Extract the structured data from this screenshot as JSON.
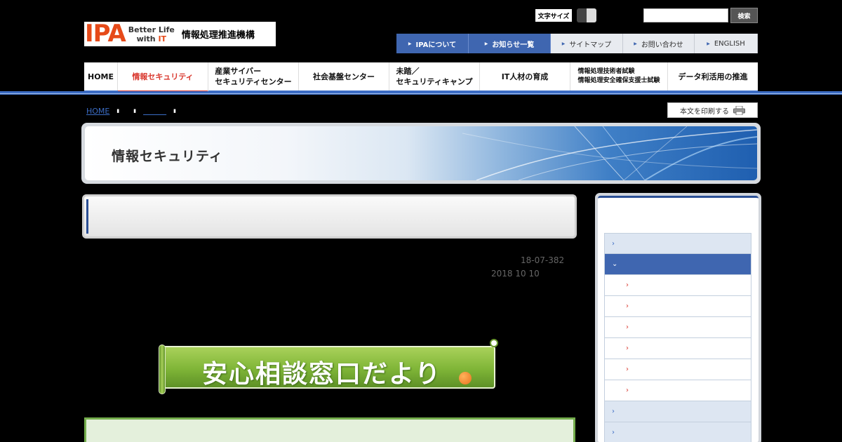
{
  "header": {
    "logo_mark": "IPA",
    "logo_tagline_1": "Better Life",
    "logo_tagline_2a": "with ",
    "logo_tagline_2b": "IT",
    "logo_org": "情報処理推進機構",
    "fontsize_label": "文字サイズ",
    "search_placeholder": "",
    "search_button": "検索"
  },
  "utility_nav": [
    {
      "label": "IPAについて",
      "style": "primary"
    },
    {
      "label": "お知らせ一覧",
      "style": "primary"
    },
    {
      "label": "サイトマップ",
      "style": "secondary"
    },
    {
      "label": "お問い合わせ",
      "style": "secondary"
    },
    {
      "label": "ENGLISH",
      "style": "secondary"
    }
  ],
  "main_nav": [
    {
      "line1": "HOME",
      "line2": ""
    },
    {
      "line1": "情報セキュリティ",
      "line2": "",
      "active": true
    },
    {
      "line1": "産業サイバー",
      "line2": "セキュリティセンター"
    },
    {
      "line1": "社会基盤センター",
      "line2": ""
    },
    {
      "line1": "未踏／",
      "line2": "セキュリティキャンプ"
    },
    {
      "line1": "IT人材の育成",
      "line2": ""
    },
    {
      "line1": "情報処理技術者試験",
      "line2": "情報処理安全確保支援士試験"
    },
    {
      "line1": "データ利活用の推進",
      "line2": ""
    }
  ],
  "breadcrumb": {
    "home": "HOME",
    "link2": "＿＿＿"
  },
  "print_button": "本文を印刷する",
  "banner_title": "情報セキュリティ",
  "doc": {
    "number": "18-07-382",
    "date": "2018 10 10"
  },
  "ribbon_text": "安心相談窓口だより",
  "sidebar": {
    "items": [
      {
        "type": "cat",
        "marker": "›"
      },
      {
        "type": "open",
        "marker": "⌄"
      },
      {
        "type": "sub",
        "marker": "›"
      },
      {
        "type": "sub",
        "marker": "›"
      },
      {
        "type": "sub",
        "marker": "›"
      },
      {
        "type": "sub",
        "marker": "›"
      },
      {
        "type": "sub",
        "marker": "›"
      },
      {
        "type": "sub",
        "marker": "›"
      },
      {
        "type": "cat",
        "marker": "›"
      },
      {
        "type": "cat",
        "marker": "›"
      }
    ]
  },
  "colors": {
    "accent_blue": "#3f66b0",
    "active_red": "#d9382e",
    "ribbon_green": "#7fb537"
  }
}
